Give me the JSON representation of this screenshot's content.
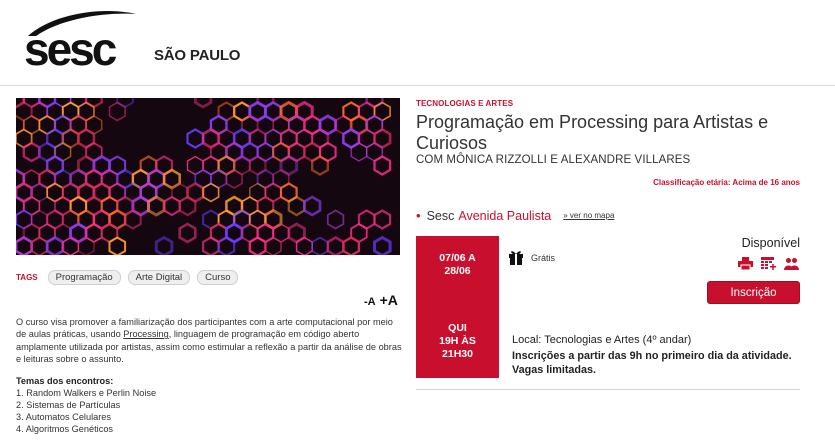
{
  "header": {
    "logo_text": "sesc",
    "region": "SÃO PAULO"
  },
  "tags": {
    "label": "TAGS",
    "items": [
      "Programação",
      "Arte Digital",
      "Curso"
    ]
  },
  "font_controls": {
    "decrease": "-A",
    "increase": "+A"
  },
  "description": {
    "before_link": "O curso visa promover a familiarização dos participantes com a arte computacional por meio de aulas práticas, usando ",
    "link": "Processing",
    "after_link": ", linguagem de programação em código aberto amplamente utilizada por artistas, assim como estimular a reflexão a partir da análise de obras e leituras sobre o assunto."
  },
  "themes": {
    "title": "Temas dos encontros:",
    "items": [
      "1. Random Walkers e Perlin Noise",
      "2. Sistemas de Partículas",
      "3. Automatos Celulares",
      "4. Algoritmos Genéticos"
    ]
  },
  "event": {
    "category": "TECNOLOGIAS E ARTES",
    "title": "Programação em Processing para Artistas e Curiosos",
    "subtitle": "COM MÔNICA RIZZOLLI E ALEXANDRE VILLARES",
    "rating": "Classificação etária: Acima de 16 anos",
    "unit_prefix": "Sesc",
    "unit_name": "Avenida Paulista",
    "map_link": "» ver no mapa",
    "dates_line1": "07/06 A",
    "dates_line2": "28/06",
    "time_line1": "QUI",
    "time_line2": "19H ÀS",
    "time_line3": "21H30",
    "price": "Grátis",
    "status": "Disponível",
    "button": "Inscrição",
    "location": "Local: Tecnologias e Artes (4º andar)",
    "notice": "Inscrições a partir das 9h no primeiro dia da atividade. Vagas limitadas."
  },
  "icons": [
    "print-icon",
    "calendar-add-icon",
    "share-people-icon",
    "gift-icon"
  ],
  "colors": {
    "accent": "#c8102e",
    "banner_bg": "#140710"
  }
}
